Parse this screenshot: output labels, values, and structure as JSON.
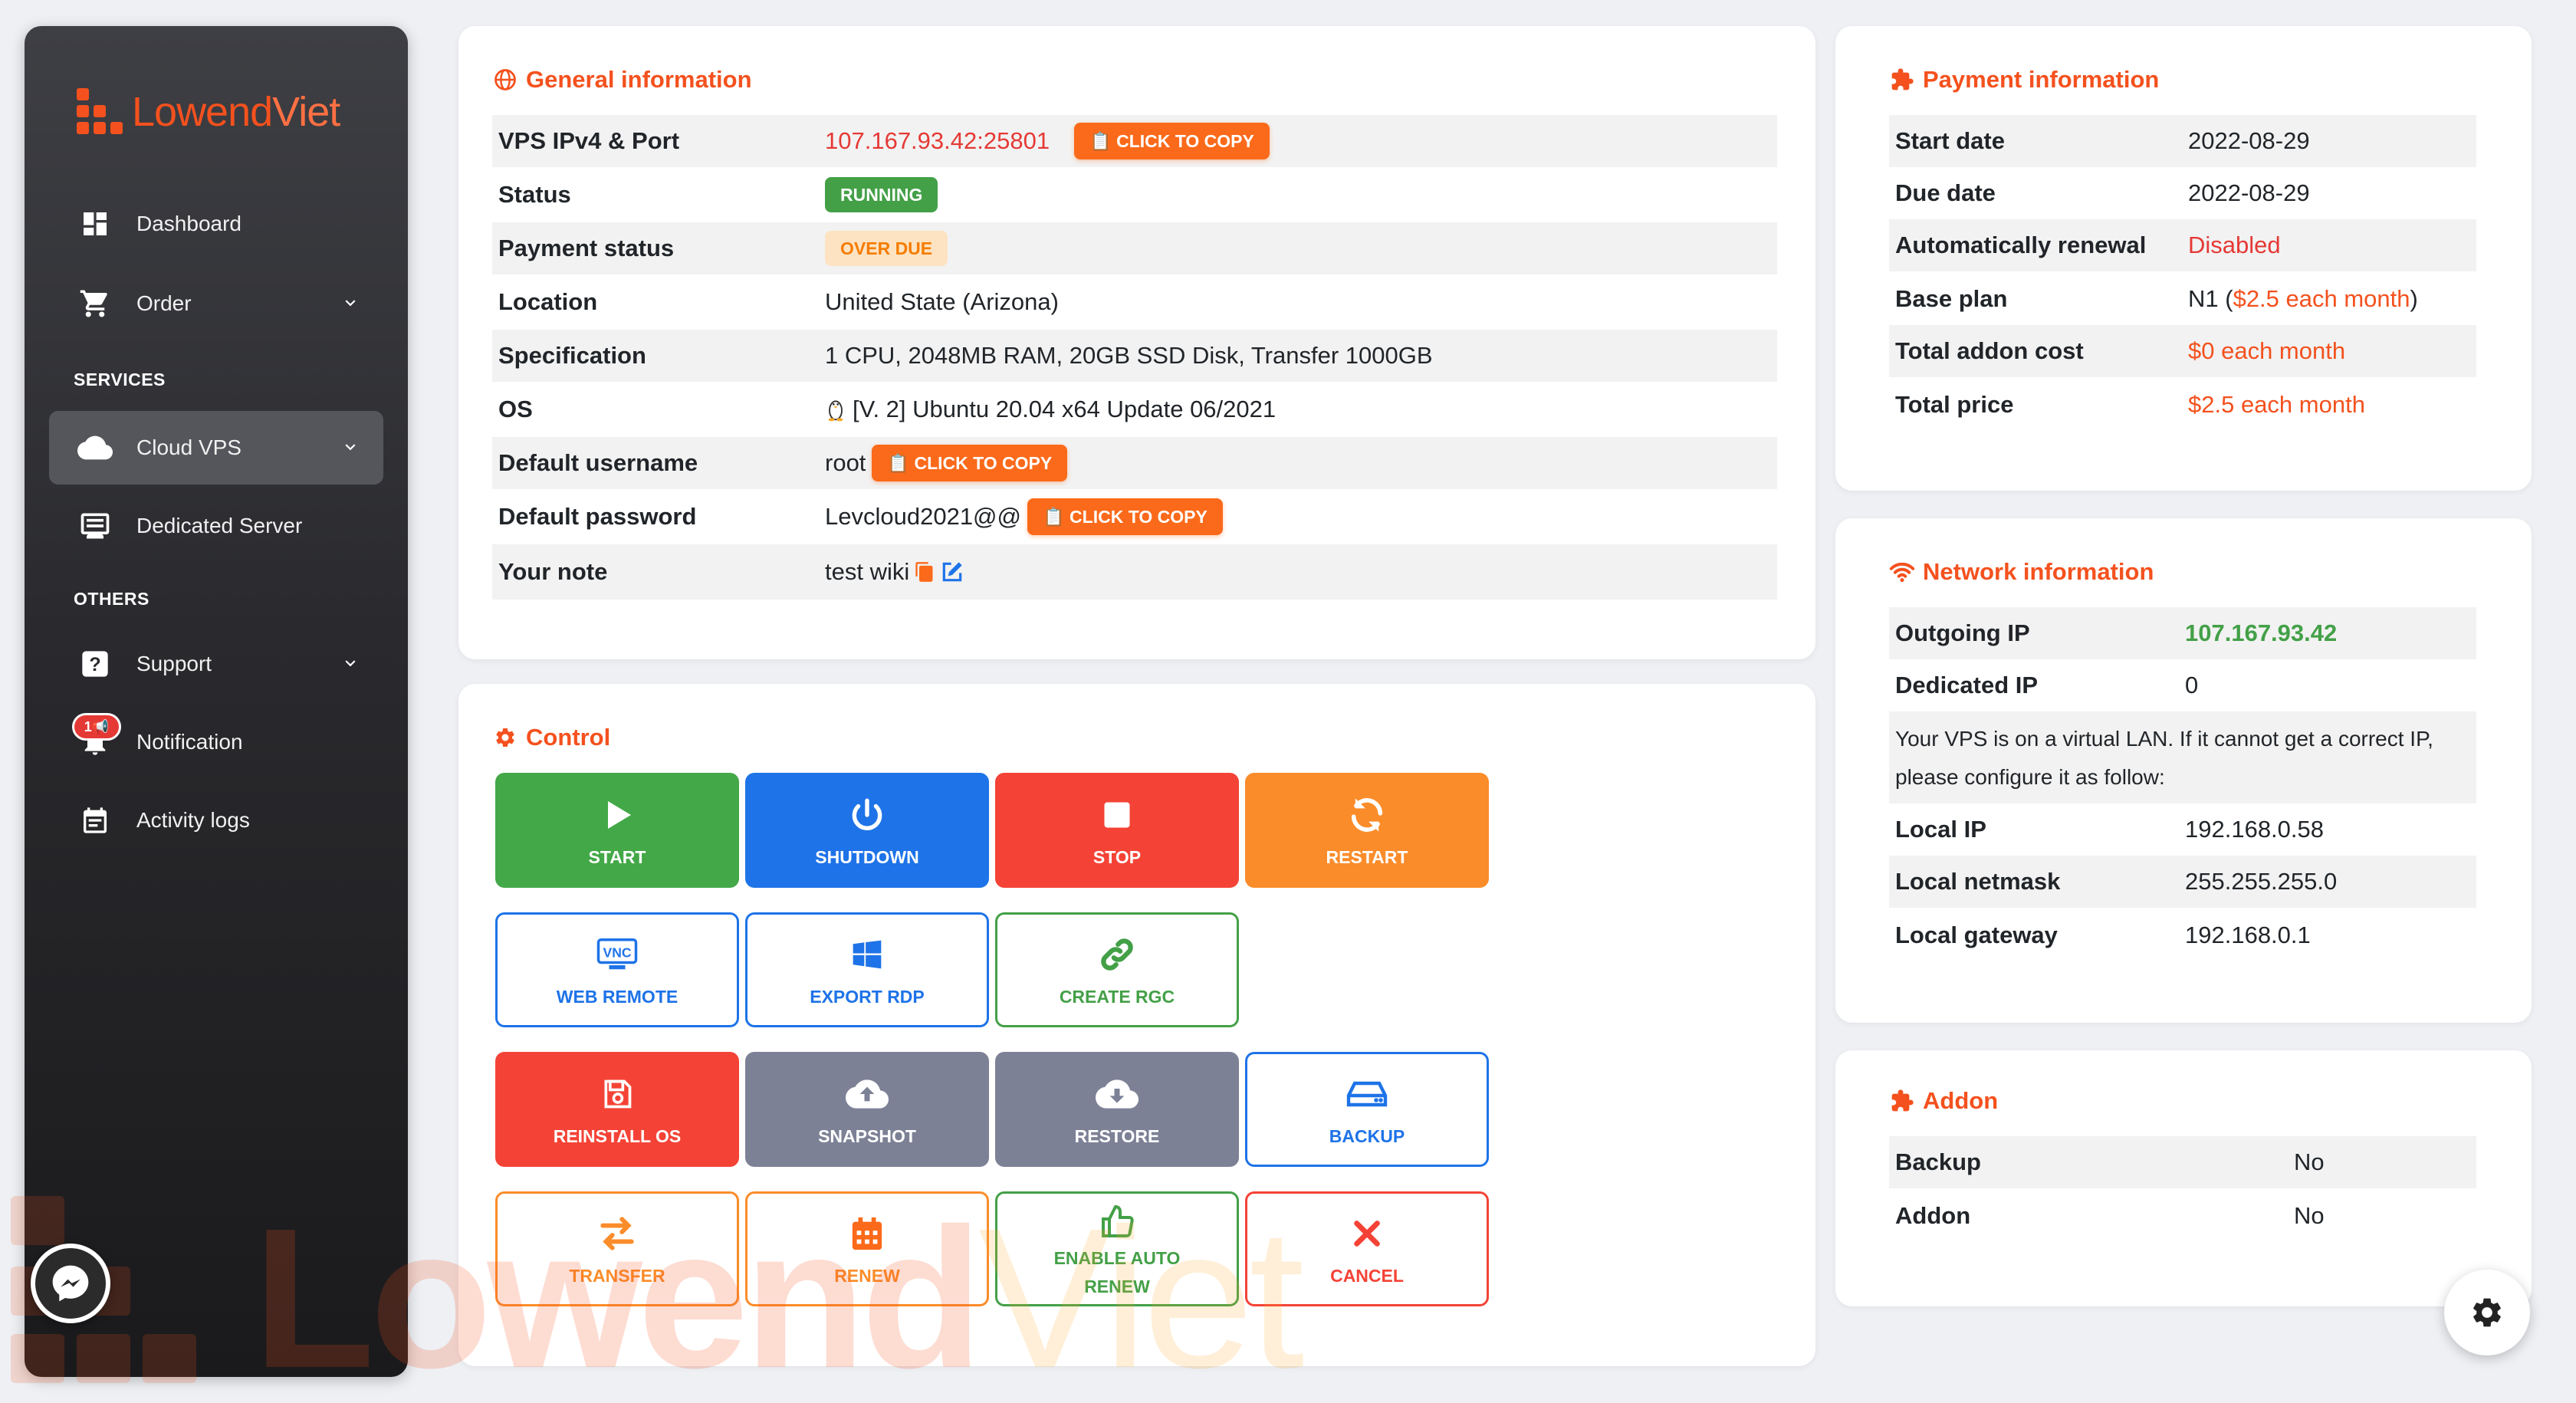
{
  "brand": {
    "name_bold": "Lowend",
    "name_light": "Viet"
  },
  "sidebar": {
    "dashboard": "Dashboard",
    "order": "Order",
    "section_services": "SERVICES",
    "cloud_vps": "Cloud VPS",
    "dedicated_server": "Dedicated Server",
    "section_others": "OTHERS",
    "support": "Support",
    "notification": "Notification",
    "notification_badge": "1",
    "activity_logs": "Activity logs"
  },
  "general": {
    "title": "General information",
    "rows": {
      "ip_label": "VPS IPv4 & Port",
      "ip_value": "107.167.93.42:25801",
      "status_label": "Status",
      "status_value": "RUNNING",
      "payment_label": "Payment status",
      "payment_value": "OVER DUE",
      "location_label": "Location",
      "location_value": "United State (Arizona)",
      "spec_label": "Specification",
      "spec_value": "1 CPU, 2048MB RAM, 20GB SSD Disk, Transfer 1000GB",
      "os_label": "OS",
      "os_value": "[V. 2] Ubuntu 20.04 x64 Update 06/2021",
      "user_label": "Default username",
      "user_value": "root",
      "pass_label": "Default password",
      "pass_value": "Levcloud2021@@",
      "note_label": "Your note",
      "note_value": "test wiki"
    },
    "copy_label": "CLICK TO COPY"
  },
  "control": {
    "title": "Control",
    "start": "START",
    "shutdown": "SHUTDOWN",
    "stop": "STOP",
    "restart": "RESTART",
    "web_remote": "WEB REMOTE",
    "vnc": "VNC",
    "export_rdp": "EXPORT RDP",
    "create_rgc": "CREATE RGC",
    "reinstall": "REINSTALL OS",
    "snapshot": "SNAPSHOT",
    "restore": "RESTORE",
    "backup": "BACKUP",
    "transfer": "TRANSFER",
    "renew": "RENEW",
    "auto_renew_1": "ENABLE AUTO",
    "auto_renew_2": "RENEW",
    "cancel": "CANCEL"
  },
  "payment": {
    "title": "Payment information",
    "start_label": "Start date",
    "start_value": "2022-08-29",
    "due_label": "Due date",
    "due_value": "2022-08-29",
    "auto_label": "Automatically renewal",
    "auto_value": "Disabled",
    "plan_label": "Base plan",
    "plan_name": "N1 (",
    "plan_price": "$2.5 each month",
    "plan_close": ")",
    "addon_label": "Total addon cost",
    "addon_value": "$0 each month",
    "total_label": "Total price",
    "total_value": "$2.5 each month"
  },
  "network": {
    "title": "Network information",
    "outgoing_label": "Outgoing IP",
    "outgoing_value": "107.167.93.42",
    "dedicated_label": "Dedicated IP",
    "dedicated_value": "0",
    "notice_1": "Your VPS is on a virtual LAN. If it cannot get a correct IP,",
    "notice_2": "please configure it as follow:",
    "local_ip_label": "Local IP",
    "local_ip_value": "192.168.0.58",
    "netmask_label": "Local netmask",
    "netmask_value": "255.255.255.0",
    "gateway_label": "Local gateway",
    "gateway_value": "192.168.0.1"
  },
  "addon": {
    "title": "Addon",
    "backup_label": "Backup",
    "backup_value": "No",
    "addon_label": "Addon",
    "addon_value": "No"
  },
  "colors": {
    "accent": "#f4511e",
    "danger": "#e53935",
    "success": "#43a047",
    "primary": "#1e73e8"
  }
}
